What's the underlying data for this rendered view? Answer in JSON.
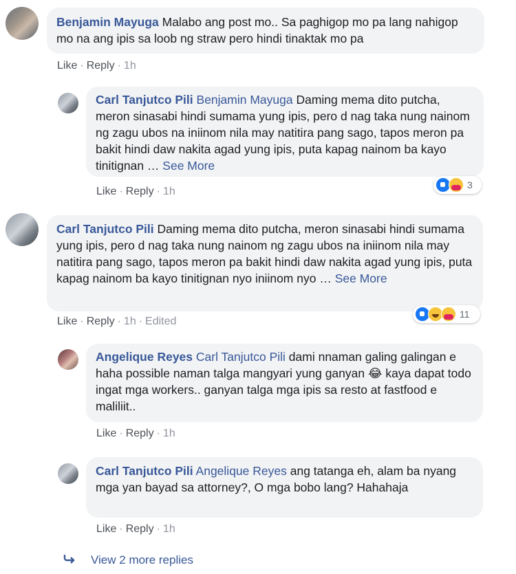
{
  "comments": [
    {
      "author": "Benjamin Mayuga",
      "text": "Malabo ang post mo.. Sa paghigop mo pa lang nahigop mo na ang ipis sa loob ng straw pero hindi tinaktak mo pa",
      "like": "Like",
      "reply": "Reply",
      "time": "1h"
    },
    {
      "author": "Carl Tanjutco Pili",
      "mention": "Benjamin Mayuga",
      "text": "Daming mema dito putcha, meron sinasabi hindi sumama yung ipis, pero d nag taka nung nainom ng zagu ubos na iniinom nila may natitira pang sago, tapos meron pa bakit hindi daw nakita agad yung ipis, puta kapag nainom ba kayo tinitignan …",
      "see_more": "See More",
      "like": "Like",
      "reply": "Reply",
      "time": "1h",
      "reaction_count": "3"
    },
    {
      "author": "Carl Tanjutco Pili",
      "text": "Daming mema dito putcha, meron sinasabi hindi sumama yung ipis, pero d nag taka nung nainom ng zagu ubos na iniinom nila may natitira pang sago, tapos meron pa bakit hindi daw nakita agad yung ipis, puta kapag nainom ba kayo tinitignan nyo iniinom nyo …",
      "see_more": "See More",
      "like": "Like",
      "reply": "Reply",
      "time": "1h",
      "edited": "Edited",
      "reaction_count": "11"
    },
    {
      "author": "Angelique Reyes",
      "mention": "Carl Tanjutco Pili",
      "text_a": "dami nnaman galing galingan e haha possible naman talga mangyari yung ganyan",
      "emoji": "😂",
      "text_b": "kaya dapat todo ingat mga workers.. ganyan talga mga ipis sa resto at fastfood e maliliit..",
      "like": "Like",
      "reply": "Reply",
      "time": "1h"
    },
    {
      "author": "Carl Tanjutco Pili",
      "mention": "Angelique Reyes",
      "text": "ang tatanga eh, alam ba nyang mga yan bayad sa attorney?, O mga bobo lang? Hahahaja",
      "like": "Like",
      "reply": "Reply",
      "time": "1h"
    }
  ],
  "view_more": "View 2 more replies",
  "icons": {
    "reply_arrow": "reply-arrow-icon",
    "reactions": [
      "like-reaction-icon",
      "haha-reaction-icon",
      "care-reaction-icon"
    ]
  },
  "colors": {
    "link": "#385898",
    "bubble": "#f2f3f5",
    "meta": "#90949c"
  }
}
